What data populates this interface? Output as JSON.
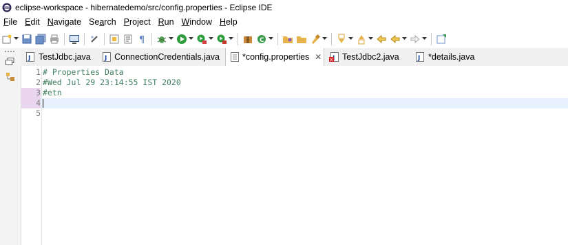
{
  "window": {
    "title": "eclipse-workspace - hibernatedemo/src/config.properties - Eclipse IDE"
  },
  "menu": [
    {
      "pre": "",
      "u": "F",
      "post": "ile"
    },
    {
      "pre": "",
      "u": "E",
      "post": "dit"
    },
    {
      "pre": "",
      "u": "N",
      "post": "avigate"
    },
    {
      "pre": "Se",
      "u": "a",
      "post": "rch"
    },
    {
      "pre": "",
      "u": "P",
      "post": "roject"
    },
    {
      "pre": "",
      "u": "R",
      "post": "un"
    },
    {
      "pre": "",
      "u": "W",
      "post": "indow"
    },
    {
      "pre": "",
      "u": "H",
      "post": "elp"
    }
  ],
  "tabs": [
    {
      "label": "TestJdbc.java",
      "icon": "java-file-icon"
    },
    {
      "label": "ConnectionCredentials.java",
      "icon": "java-file-icon"
    },
    {
      "label": "*config.properties",
      "icon": "properties-file-icon",
      "active": true
    },
    {
      "label": "TestJdbc2.java",
      "icon": "java-file-error-icon"
    },
    {
      "label": "*details.java",
      "icon": "java-file-icon"
    }
  ],
  "editor": {
    "lines": [
      {
        "num": "1",
        "text": "# Properties Data"
      },
      {
        "num": "2",
        "text": "#Wed Jul 29 23:14:55 IST 2020"
      },
      {
        "num": "3",
        "text": "#etn"
      },
      {
        "num": "4",
        "text": ""
      },
      {
        "num": "5",
        "text": ""
      }
    ]
  },
  "colors": {
    "comment": "#3f7f5f",
    "current_line": "#e8f2fe",
    "line_number": "#787878"
  }
}
